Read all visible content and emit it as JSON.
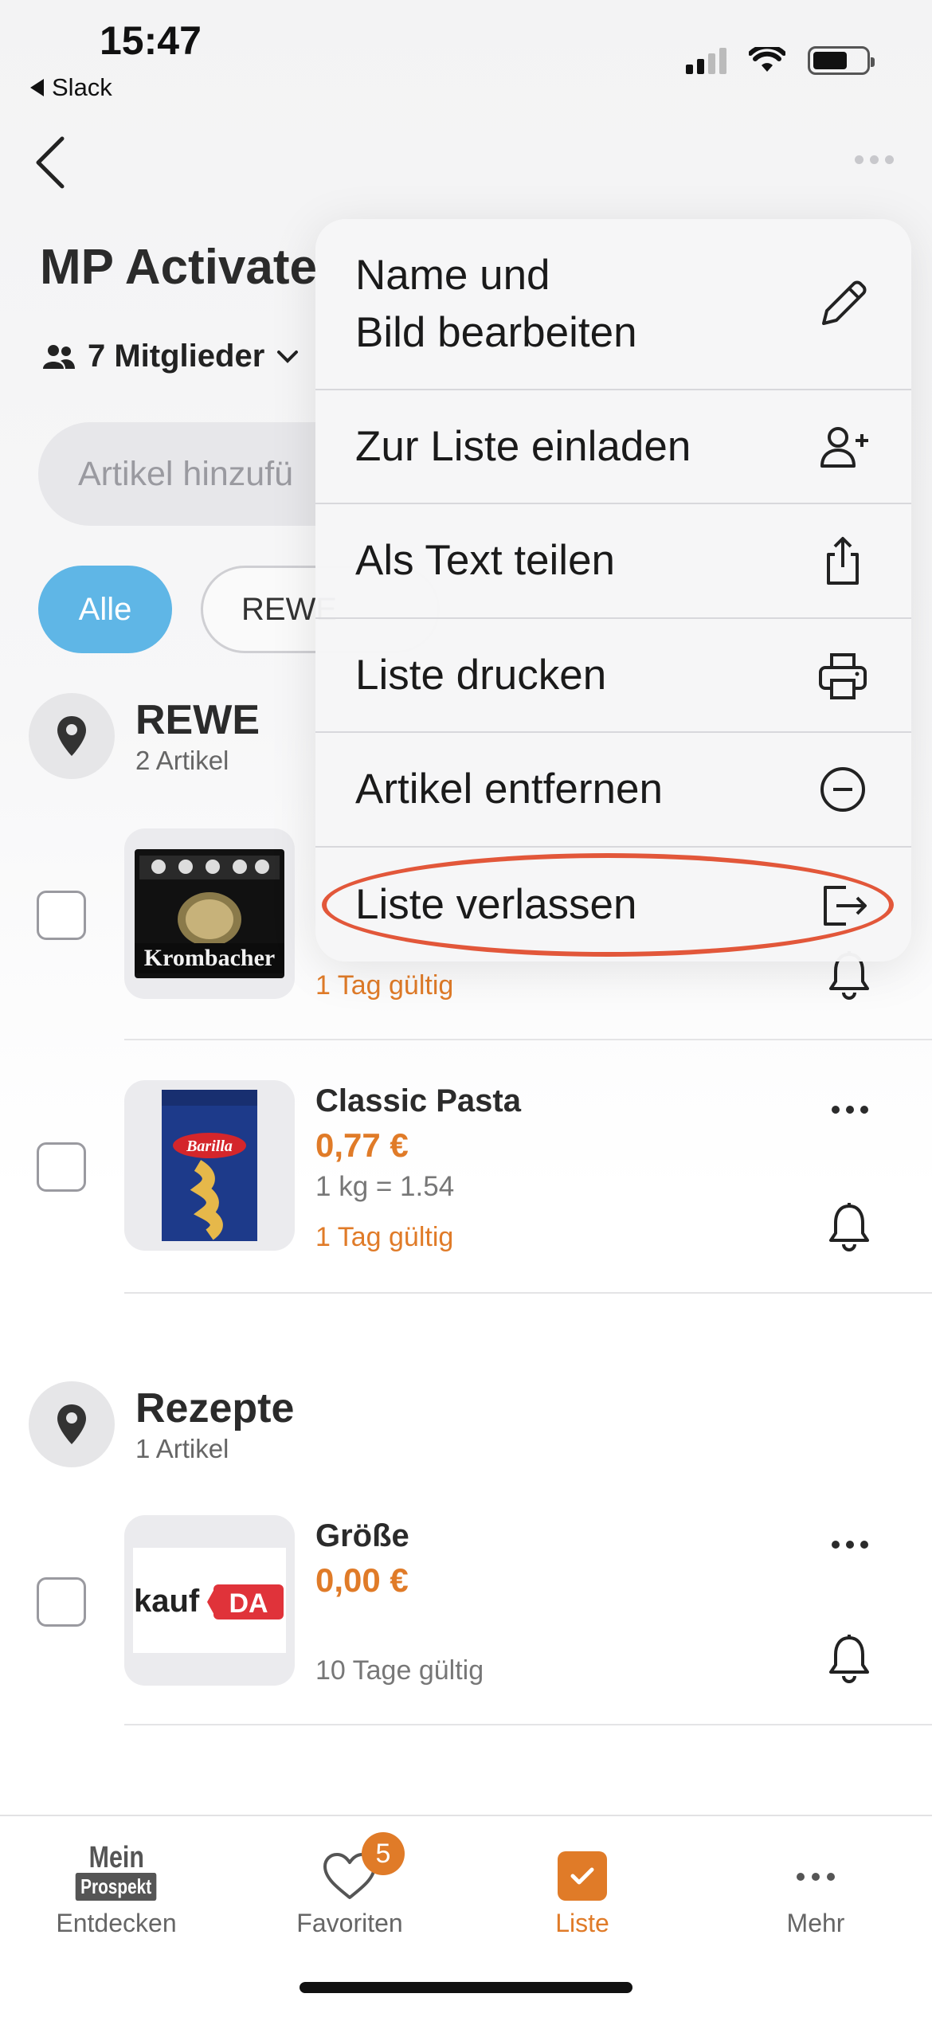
{
  "status_bar": {
    "time": "15:47",
    "back_app": "Slack"
  },
  "header": {
    "title": "MP Activate",
    "members_label": "7 Mitglieder"
  },
  "search": {
    "placeholder": "Artikel hinzufü"
  },
  "filters": [
    {
      "label": "Alle",
      "active": true
    },
    {
      "label": "REWE",
      "active": false
    }
  ],
  "menu": {
    "items": [
      {
        "label_line1": "Name und",
        "label_line2": "Bild bearbeiten",
        "icon": "pencil-icon"
      },
      {
        "label": "Zur Liste einladen",
        "icon": "add-person-icon"
      },
      {
        "label": "Als Text teilen",
        "icon": "share-icon"
      },
      {
        "label": "Liste drucken",
        "icon": "printer-icon"
      },
      {
        "label": "Artikel entfernen",
        "icon": "minus-circle-icon"
      },
      {
        "label": "Liste verlassen",
        "icon": "leave-icon",
        "highlighted": true
      }
    ]
  },
  "sections": [
    {
      "name": "REWE",
      "count": "2 Artikel",
      "items": [
        {
          "name": "",
          "price": "",
          "unit": "",
          "validity": "1 Tag gültig",
          "image_brand": "Krombacher"
        },
        {
          "name": "Classic Pasta",
          "price": "0,77 €",
          "unit": "1 kg = 1.54",
          "validity": "1 Tag gültig",
          "image_brand": "Barilla"
        }
      ]
    },
    {
      "name": "Rezepte",
      "count": "1 Artikel",
      "items": [
        {
          "name": "Größe",
          "price": "0,00 €",
          "unit": "",
          "validity": "10 Tage gültig",
          "image_brand": "kaufDA"
        }
      ]
    }
  ],
  "tabbar": {
    "tabs": [
      {
        "label": "Entdecken",
        "logo_line1": "Mein",
        "logo_line2": "Prospekt"
      },
      {
        "label": "Favoriten",
        "badge": "5"
      },
      {
        "label": "Liste",
        "active": true
      },
      {
        "label": "Mehr"
      }
    ]
  },
  "colors": {
    "accent": "#e07b28",
    "chip_active": "#5fb6e6",
    "highlight": "#e2573a"
  }
}
